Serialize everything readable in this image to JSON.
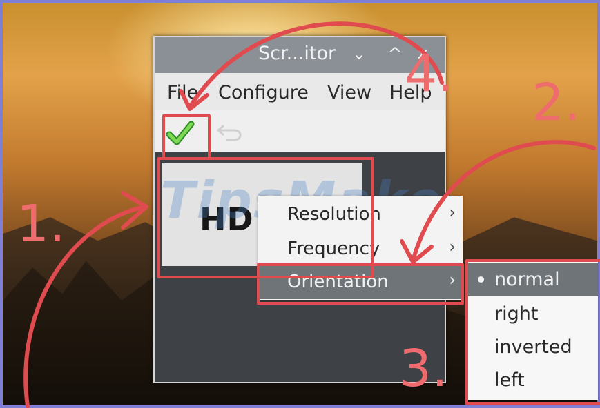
{
  "window": {
    "title": "Scr...itor",
    "buttons": {
      "dropdown": "⌄",
      "maximize": "^",
      "close": "×"
    }
  },
  "menubar": {
    "items": [
      "File",
      "Configure",
      "View",
      "Help"
    ]
  },
  "toolbar": {
    "apply_icon": "check-icon",
    "undo_icon": "undo-icon"
  },
  "display": {
    "label": "HD"
  },
  "context_menu": {
    "items": [
      {
        "label": "Resolution",
        "arrow": "›"
      },
      {
        "label": "Frequency",
        "arrow": "›"
      },
      {
        "label": "Orientation",
        "arrow": "›",
        "selected": true
      }
    ]
  },
  "orientation_submenu": {
    "items": [
      {
        "label": "normal",
        "selected": true
      },
      {
        "label": "right"
      },
      {
        "label": "inverted"
      },
      {
        "label": "left"
      }
    ]
  },
  "annotations": {
    "step1": "1.",
    "step2": "2.",
    "step3": "3.",
    "step4": "4.",
    "color": "#e04b50"
  },
  "watermark": {
    "text": "TipsMake"
  }
}
